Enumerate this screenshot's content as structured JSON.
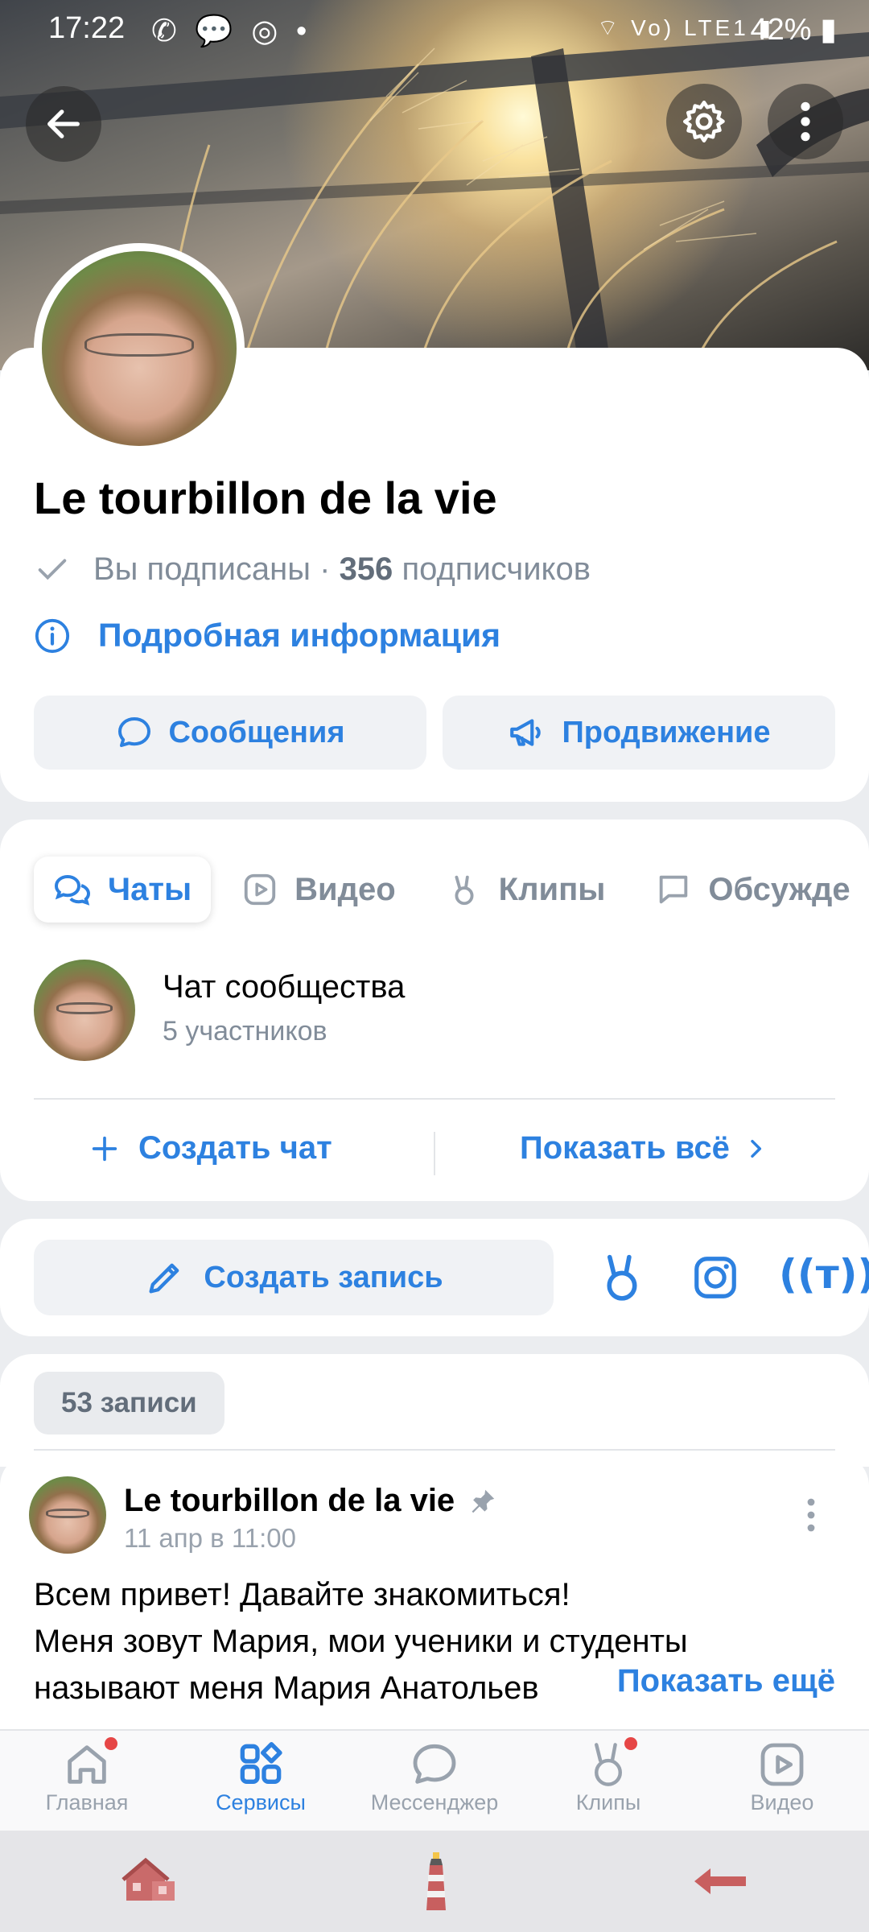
{
  "status_bar": {
    "time": "17:22",
    "battery": "42%",
    "network": "Vo) LTE1"
  },
  "community": {
    "name": "Le tourbillon de la vie",
    "subscribed_text": "Вы подписаны ·",
    "subscribers_count": "356",
    "subscribers_label": "подписчиков",
    "details_link": "Подробная информация"
  },
  "actions": {
    "messages": "Сообщения",
    "promotion": "Продвижение"
  },
  "tabs": [
    {
      "label": "Чаты",
      "icon": "chats-icon",
      "active": true
    },
    {
      "label": "Видео",
      "icon": "video-icon"
    },
    {
      "label": "Клипы",
      "icon": "clips-icon"
    },
    {
      "label": "Обсужде",
      "icon": "discussion-icon"
    }
  ],
  "chat": {
    "name": "Чат сообщества",
    "members": "5 участников"
  },
  "chat_actions": {
    "create": "Создать чат",
    "show_all": "Показать всё"
  },
  "composer": {
    "create_post": "Создать запись"
  },
  "records_badge": "53 записи",
  "post": {
    "author": "Le tourbillon de la vie",
    "date": "11 апр в 11:00",
    "lines": [
      "Всем привет! Давайте знакомиться!",
      "Меня зовут Мария, мои ученики и студенты",
      "называют меня Мария Анатольев"
    ],
    "show_more": "Показать ещё"
  },
  "tabbar": [
    {
      "label": "Главная",
      "icon": "home-icon",
      "badge": true
    },
    {
      "label": "Сервисы",
      "icon": "services-icon",
      "active": true
    },
    {
      "label": "Мессенджер",
      "icon": "messenger-icon"
    },
    {
      "label": "Клипы",
      "icon": "clips-icon",
      "badge": true
    },
    {
      "label": "Видео",
      "icon": "video-icon"
    }
  ],
  "colors": {
    "accent": "#2d81e0",
    "secondary_text": "#818c99",
    "badge": "#e64646"
  }
}
